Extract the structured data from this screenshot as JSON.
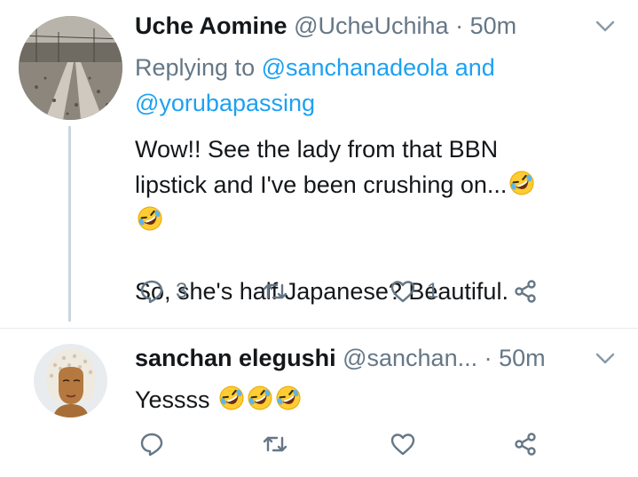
{
  "tweets": [
    {
      "name": "Uche Aomine",
      "handle": "@UcheUchiha",
      "separator": "·",
      "time": "50m",
      "replying_prefix": "Replying to",
      "replying_mentions": [
        "@sanchanadeola",
        "and",
        "@yorubapassing"
      ],
      "text_line1": "Wow!! See the lady from that BBN lipstick and I've been crushing on...",
      "text_line2": "So, she's half Japanese? Beautiful.",
      "emojis": [
        "rolling-on-floor-laughing-emoji",
        "rolling-on-floor-laughing-emoji"
      ],
      "reply_count": "3",
      "retweet_count": "",
      "like_count": "1"
    },
    {
      "name": "sanchan elegushi",
      "handle": "@sanchan...",
      "separator": "·",
      "time": "50m",
      "text_line1": "Yessss",
      "emojis": [
        "rolling-on-floor-laughing-emoji",
        "rolling-on-floor-laughing-emoji",
        "rolling-on-floor-laughing-emoji"
      ],
      "reply_count": "",
      "retweet_count": "",
      "like_count": ""
    }
  ],
  "icons": {
    "reply": "reply-icon",
    "retweet": "retweet-icon",
    "like": "heart-icon",
    "share": "share-icon",
    "menu": "chevron-down-icon"
  },
  "colors": {
    "link": "#1da1f2",
    "secondary_text": "#657786",
    "icon": "#657786",
    "thread_line": "#ccd6dd"
  }
}
